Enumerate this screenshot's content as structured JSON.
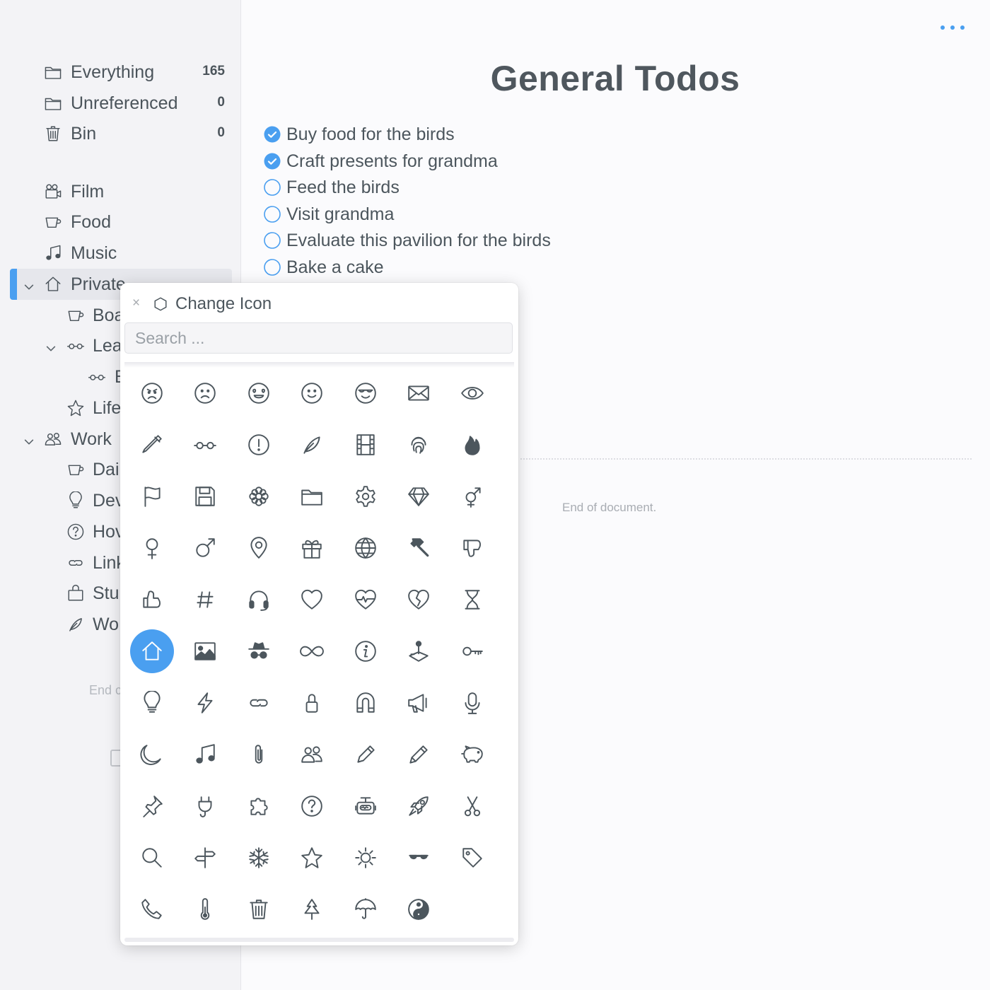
{
  "sidebar": {
    "items": [
      {
        "label": "Everything",
        "count": "165",
        "icon": "folder-icon"
      },
      {
        "label": "Unreferenced",
        "count": "0",
        "icon": "folder-icon"
      },
      {
        "label": "Bin",
        "count": "0",
        "icon": "trash-icon"
      },
      {
        "label": "Film",
        "icon": "video-camera-icon"
      },
      {
        "label": "Food",
        "icon": "cup-icon"
      },
      {
        "label": "Music",
        "icon": "music-note-icon"
      },
      {
        "label": "Private",
        "icon": "home-icon",
        "selected": true,
        "expanded": true
      },
      {
        "label": "Boa",
        "icon": "cup-icon"
      },
      {
        "label": "Lea",
        "icon": "glasses-icon",
        "expanded": true
      },
      {
        "label": "E",
        "icon": "glasses-icon"
      },
      {
        "label": "Life",
        "icon": "star-icon"
      },
      {
        "label": "Work",
        "icon": "people-icon",
        "expanded": true
      },
      {
        "label": "Dai",
        "icon": "cup-icon"
      },
      {
        "label": "Dev",
        "icon": "lightbulb-icon"
      },
      {
        "label": "Hov",
        "icon": "question-icon"
      },
      {
        "label": "Link",
        "icon": "link-icon"
      },
      {
        "label": "Stu",
        "icon": "bag-icon"
      },
      {
        "label": "Wo",
        "icon": "feather-icon"
      }
    ],
    "end_text": "End c"
  },
  "main": {
    "title": "General Todos",
    "todos": [
      {
        "text": "Buy food for the birds",
        "done": true
      },
      {
        "text": "Craft presents for grandma",
        "done": true
      },
      {
        "text": "Feed the birds",
        "done": false
      },
      {
        "text": "Visit grandma",
        "done": false
      },
      {
        "text": "Evaluate this pavilion for the birds",
        "done": false
      },
      {
        "text": "Bake a cake",
        "done": false
      }
    ],
    "end_text": "End of document."
  },
  "popover": {
    "close_label": "×",
    "title": "Change Icon",
    "search_placeholder": "Search ...",
    "selected_icon": "home-icon",
    "icons": [
      "angry-face-icon",
      "sad-face-icon",
      "heart-eyes-face-icon",
      "smile-face-icon",
      "sunglasses-face-icon",
      "envelope-icon",
      "eye-icon",
      "pipette-icon",
      "glasses-icon",
      "exclamation-circle-icon",
      "feather-icon",
      "film-strip-icon",
      "fingerprint-icon",
      "fire-icon",
      "flag-icon",
      "floppy-disk-icon",
      "flower-icon",
      "folder-icon",
      "gear-icon",
      "diamond-icon",
      "gender-icon",
      "female-icon",
      "male-icon",
      "map-pin-icon",
      "gift-icon",
      "globe-icon",
      "hammer-icon",
      "thumbs-down-icon",
      "thumbs-up-icon",
      "hashtag-icon",
      "headphones-icon",
      "heart-icon",
      "heartbeat-icon",
      "broken-heart-icon",
      "hourglass-icon",
      "home-icon",
      "image-icon",
      "incognito-icon",
      "infinity-icon",
      "info-icon",
      "joystick-icon",
      "key-icon",
      "lightbulb-icon",
      "lightning-icon",
      "link-icon",
      "lock-icon",
      "magnet-icon",
      "megaphone-icon",
      "microphone-icon",
      "moon-icon",
      "music-note-icon",
      "paperclip-icon",
      "people-icon",
      "pen-icon",
      "pencil-icon",
      "piggy-bank-icon",
      "pin-icon",
      "plug-icon",
      "puzzle-icon",
      "question-icon",
      "robot-icon",
      "rocket-icon",
      "scissors-icon",
      "search-icon",
      "signpost-icon",
      "snowflake-icon",
      "star-icon",
      "sun-icon",
      "sunglasses-icon",
      "tag-icon",
      "phone-icon",
      "thermometer-icon",
      "trash-icon",
      "tree-icon",
      "umbrella-icon",
      "yin-yang-icon"
    ]
  },
  "colors": {
    "accent": "#4a9ff0",
    "text": "#4c565d",
    "sidebar_bg": "#f3f3f6"
  }
}
